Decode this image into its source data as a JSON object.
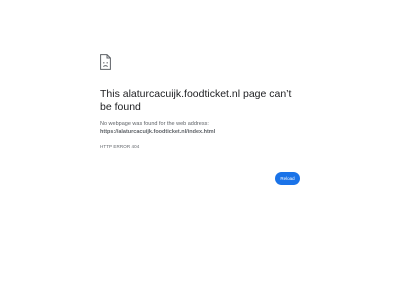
{
  "error_page": {
    "icon": "sad-document-icon",
    "title": "This alaturcacuijk.foodticket.nl page can’t be found",
    "description": "No webpage was found for the web address:",
    "url": "https://alaturcacuijk.foodticket.nl/index.html",
    "error_code": "HTTP ERROR 404",
    "reload_label": "Reload"
  },
  "colors": {
    "accent": "#1a73e8",
    "title_text": "#202124",
    "secondary_text": "#5f6368",
    "background": "#ffffff"
  }
}
